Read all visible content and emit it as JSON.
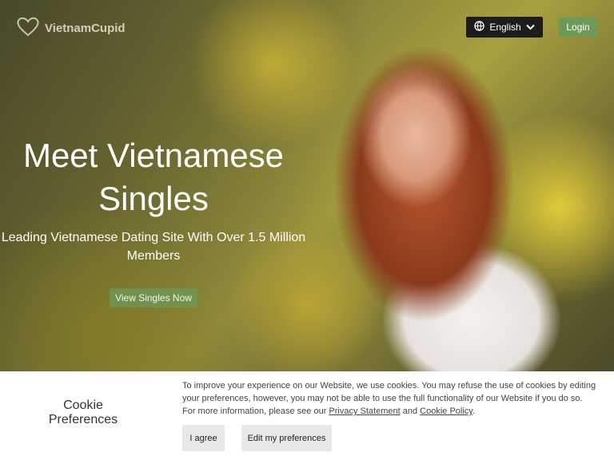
{
  "header": {
    "brand": "VietnamCupid",
    "language_label": "English",
    "login_label": "Login"
  },
  "hero": {
    "headline_line1": "Meet Vietnamese",
    "headline_line2": "Singles",
    "subline_line1": "Leading Vietnamese Dating Site With Over 1.5 Million",
    "subline_line2": "Members",
    "cta_label": "View Singles Now"
  },
  "cookie": {
    "title_line1": "Cookie",
    "title_line2": "Preferences",
    "text_main": "To improve your experience on our Website, we use cookies. You may refuse the use of cookies by editing your preferences, however, you may not be able to use the full functionality of our Website if you do so. For more information, please see our ",
    "privacy_link": "Privacy Statement",
    "and_text": " and ",
    "cookie_link": "Cookie Policy",
    "end_text": ".",
    "agree_label": "I agree",
    "edit_label": "Edit my preferences"
  },
  "icons": {
    "logo": "heart-icon",
    "language": "globe-icon",
    "dropdown": "chevron-down-icon"
  }
}
